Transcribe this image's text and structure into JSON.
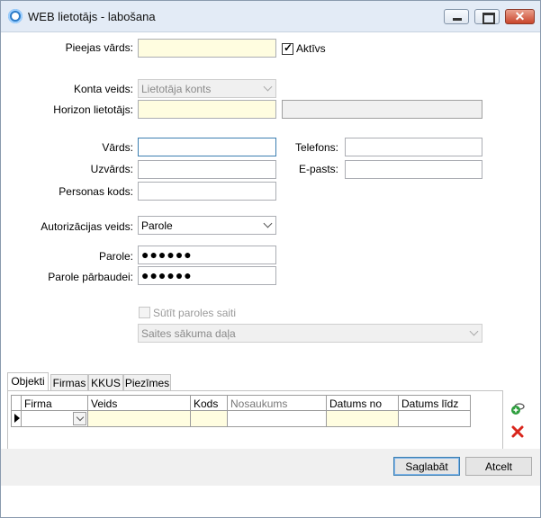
{
  "window": {
    "title": "WEB lietotājs - labošana"
  },
  "form": {
    "login_label": "Pieejas vārds:",
    "login_value": "",
    "active_label": "Aktīvs",
    "active_checked": true,
    "account_type_label": "Konta veids:",
    "account_type_value": "Lietotāja konts",
    "horizon_label": "Horizon lietotājs:",
    "horizon_value": "",
    "horizon_extra_value": "",
    "first_name_label": "Vārds:",
    "first_name_value": "",
    "last_name_label": "Uzvārds:",
    "last_name_value": "",
    "personal_code_label": "Personas kods:",
    "personal_code_value": "",
    "phone_label": "Telefons:",
    "phone_value": "",
    "email_label": "E-pasts:",
    "email_value": "",
    "auth_type_label": "Autorizācijas veids:",
    "auth_type_value": "Parole",
    "password_label": "Parole:",
    "password_mask": "●●●●●●",
    "password_confirm_label": "Parole pārbaudei:",
    "password_confirm_mask": "●●●●●●",
    "send_link_label": "Sūtīt paroles saiti",
    "send_link_checked": false,
    "start_page_placeholder": "Saites sākuma daļa"
  },
  "tabs": [
    {
      "label": "Objekti",
      "active": true
    },
    {
      "label": "Firmas",
      "active": false
    },
    {
      "label": "KKUS",
      "active": false
    },
    {
      "label": "Piezīmes",
      "active": false
    }
  ],
  "grid": {
    "columns": [
      "Firma",
      "Veids",
      "Kods",
      "Nosaukums",
      "Datums no",
      "Datums līdz"
    ],
    "rows": [
      [
        "",
        "",
        "",
        "",
        "",
        ""
      ]
    ]
  },
  "footer": {
    "save_label": "Saglabāt",
    "cancel_label": "Atcelt"
  },
  "icons": {
    "app": "globe-app-icon",
    "add_row": "add-row-icon",
    "delete_row": "delete-row-icon"
  },
  "colors": {
    "required_field": "#fffde0",
    "focus_border": "#3c7fb1",
    "delete_red": "#d9261c",
    "add_green": "#2e9e3e"
  }
}
